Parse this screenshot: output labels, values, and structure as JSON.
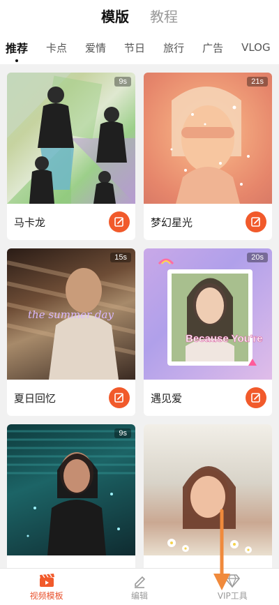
{
  "header": {
    "tabs": [
      {
        "label": "模版",
        "active": true
      },
      {
        "label": "教程",
        "active": false
      }
    ]
  },
  "categories": [
    {
      "label": "推荐",
      "active": true
    },
    {
      "label": "卡点",
      "active": false
    },
    {
      "label": "爱情",
      "active": false
    },
    {
      "label": "节日",
      "active": false
    },
    {
      "label": "旅行",
      "active": false
    },
    {
      "label": "广告",
      "active": false
    },
    {
      "label": "VLOG",
      "active": false
    }
  ],
  "templates": [
    {
      "title": "马卡龙",
      "duration": "9s",
      "thumb_overlay": ""
    },
    {
      "title": "梦幻星光",
      "duration": "21s",
      "thumb_overlay": ""
    },
    {
      "title": "夏日回忆",
      "duration": "15s",
      "thumb_overlay": "the summer day"
    },
    {
      "title": "遇见爱",
      "duration": "20s",
      "thumb_overlay": "Because You're"
    },
    {
      "title": "",
      "duration": "9s",
      "thumb_overlay": ""
    },
    {
      "title": "",
      "duration": "",
      "thumb_overlay": ""
    }
  ],
  "bottom_nav": [
    {
      "label": "视频模板",
      "icon": "clapperboard-icon",
      "active": true
    },
    {
      "label": "编辑",
      "icon": "pencil-icon",
      "active": false
    },
    {
      "label": "VIP工具",
      "icon": "diamond-icon",
      "active": false
    }
  ],
  "colors": {
    "accent": "#f15a2b",
    "nav_active": "#e8512c",
    "annotation_arrow": "#f08a3c"
  }
}
